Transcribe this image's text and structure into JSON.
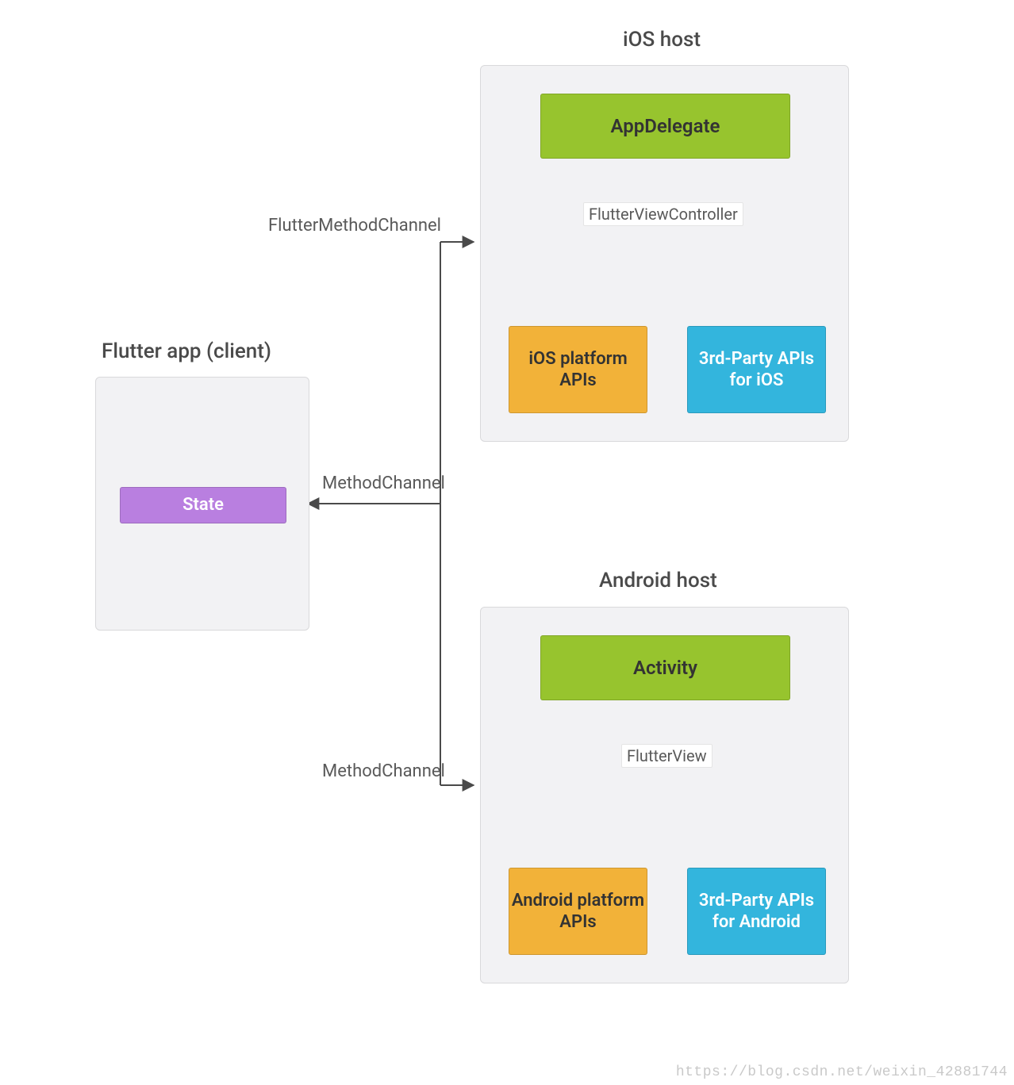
{
  "client": {
    "title": "Flutter app (client)",
    "state_label": "State"
  },
  "ios": {
    "title": "iOS host",
    "top_box": "AppDelegate",
    "view_label": "FlutterViewController",
    "left_api": "iOS platform APIs",
    "right_api": "3rd-Party APIs for iOS"
  },
  "android": {
    "title": "Android host",
    "top_box": "Activity",
    "view_label": "FlutterView",
    "left_api": "Android platform APIs",
    "right_api": "3rd-Party APIs for Android"
  },
  "labels": {
    "ios_channel": "FlutterMethodChannel",
    "mid_channel": "MethodChannel",
    "android_channel": "MethodChannel"
  },
  "watermark": "https://blog.csdn.net/weixin_42881744"
}
